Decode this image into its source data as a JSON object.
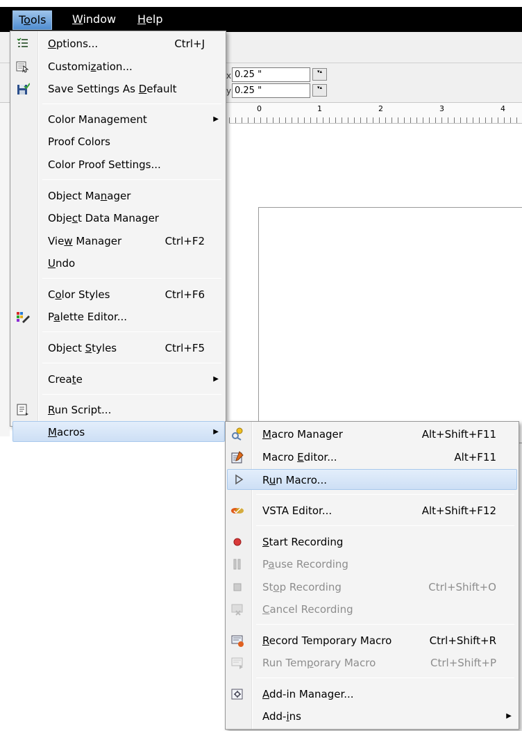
{
  "menubar": {
    "tools": {
      "pre": "T",
      "u": "o",
      "post": "ols"
    },
    "window": {
      "pre": "",
      "u": "W",
      "post": "indow"
    },
    "help": {
      "pre": "",
      "u": "H",
      "post": "elp"
    }
  },
  "toolbar": {
    "x_value": "0.25 \"",
    "y_value": "0.25 \"",
    "x_label": "x",
    "y_label": "y"
  },
  "ruler": {
    "ticks": [
      "0",
      "1",
      "2",
      "3",
      "4"
    ]
  },
  "tools_menu": {
    "options": {
      "pre": "",
      "u": "O",
      "post": "ptions...",
      "shortcut": "Ctrl+J"
    },
    "customization": {
      "pre": "Customi",
      "u": "z",
      "post": "ation..."
    },
    "save_settings": {
      "pre": "Save Settings As ",
      "u": "D",
      "post": "efault"
    },
    "color_management": "Color Management",
    "proof_colors": "Proof Colors",
    "color_proof_settings": "Color Proof Settings...",
    "object_manager": {
      "pre": "Object Ma",
      "u": "n",
      "post": "ager"
    },
    "object_data_manager": {
      "pre": "Obje",
      "u": "c",
      "post": "t Data Manager"
    },
    "view_manager": {
      "pre": "Vie",
      "u": "w",
      "post": " Manager",
      "shortcut": "Ctrl+F2"
    },
    "undo": {
      "pre": "",
      "u": "U",
      "post": "ndo"
    },
    "color_styles": {
      "pre": "C",
      "u": "o",
      "post": "lor Styles",
      "shortcut": "Ctrl+F6"
    },
    "palette_editor": {
      "pre": "P",
      "u": "a",
      "post": "lette Editor..."
    },
    "object_styles": {
      "pre": "Object ",
      "u": "S",
      "post": "tyles",
      "shortcut": "Ctrl+F5"
    },
    "create": {
      "pre": "Crea",
      "u": "t",
      "post": "e"
    },
    "run_script": {
      "pre": "",
      "u": "R",
      "post": "un Script..."
    },
    "macros": {
      "pre": "",
      "u": "M",
      "post": "acros"
    }
  },
  "macros_menu": {
    "macro_manager": {
      "pre": "",
      "u": "M",
      "post": "acro Manager",
      "shortcut": "Alt+Shift+F11"
    },
    "macro_editor": {
      "pre": "Macro ",
      "u": "E",
      "post": "ditor...",
      "shortcut": "Alt+F11"
    },
    "run_macro": {
      "pre": "R",
      "u": "u",
      "post": "n Macro..."
    },
    "vsta_editor": {
      "pre": "VSTA Editor...",
      "u": "",
      "post": "",
      "shortcut": "Alt+Shift+F12"
    },
    "start_recording": {
      "pre": "",
      "u": "S",
      "post": "tart Recording"
    },
    "pause_recording": {
      "pre": "P",
      "u": "a",
      "post": "use Recording"
    },
    "stop_recording": {
      "pre": "St",
      "u": "o",
      "post": "p Recording",
      "shortcut": "Ctrl+Shift+O"
    },
    "cancel_recording": {
      "pre": "",
      "u": "C",
      "post": "ancel Recording"
    },
    "record_temp_macro": {
      "pre": "",
      "u": "R",
      "post": "ecord Temporary Macro",
      "shortcut": "Ctrl+Shift+R"
    },
    "run_temp_macro": {
      "pre": "Run Tem",
      "u": "p",
      "post": "orary Macro",
      "shortcut": "Ctrl+Shift+P"
    },
    "addin_manager": {
      "pre": "",
      "u": "A",
      "post": "dd-in Manager..."
    },
    "addins": {
      "pre": "Add-",
      "u": "i",
      "post": "ns"
    }
  }
}
